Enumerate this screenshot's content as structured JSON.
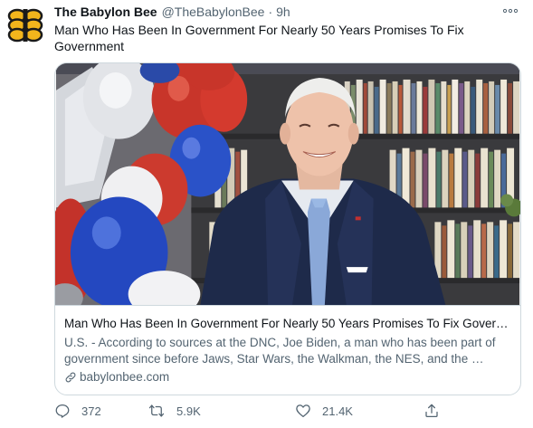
{
  "tweet": {
    "author": {
      "display_name": "The Babylon Bee",
      "handle": "@TheBabylonBee",
      "separator": "·",
      "time": "9h",
      "avatar_icon": "babylon-bee-logo-icon"
    },
    "text": "Man Who Has Been In Government For Nearly 50 Years Promises To Fix Government",
    "card": {
      "title": "Man Who Has Been In Government For Nearly 50 Years Promises To Fix Gover…",
      "description": "U.S. - According to sources at the DNC, Joe Biden, a man who has been part of government since before Jaws, Star Wars, the Walkman, the NES, and the …",
      "domain": "babylonbee.com",
      "image_description_icon": "photo-balloons-bookshelf"
    },
    "actions": {
      "reply_count": "372",
      "retweet_count": "5.9K",
      "like_count": "21.4K"
    }
  },
  "colors": {
    "text_primary": "#0f1419",
    "text_secondary": "#536471",
    "border": "#cfd9de",
    "logo_yellow": "#f2b51c"
  }
}
